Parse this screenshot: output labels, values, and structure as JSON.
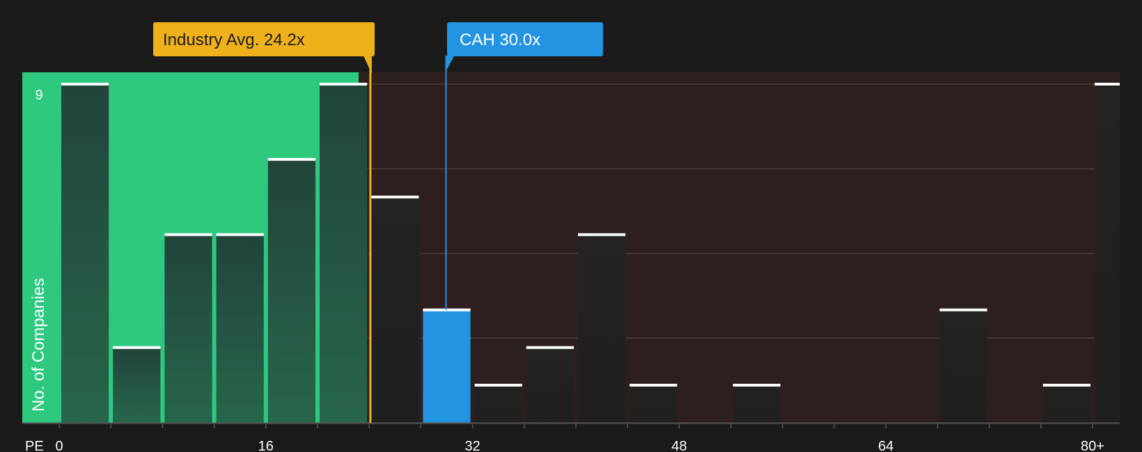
{
  "chart_data": {
    "type": "bar",
    "xlabel": "PE",
    "ylabel": "No. of Companies",
    "x_ticks": [
      "0",
      "16",
      "32",
      "48",
      "64",
      "80+"
    ],
    "y_max_label": "9",
    "ylim": [
      0,
      9
    ],
    "xlim": [
      0,
      80
    ],
    "bin_width": 4,
    "bins": [
      {
        "start": 0,
        "count": 9
      },
      {
        "start": 4,
        "count": 2
      },
      {
        "start": 8,
        "count": 5
      },
      {
        "start": 12,
        "count": 5
      },
      {
        "start": 16,
        "count": 7
      },
      {
        "start": 20,
        "count": 9
      },
      {
        "start": 24,
        "count": 6
      },
      {
        "start": 28,
        "count": 3,
        "highlight": true
      },
      {
        "start": 32,
        "count": 1
      },
      {
        "start": 36,
        "count": 2
      },
      {
        "start": 40,
        "count": 5
      },
      {
        "start": 44,
        "count": 1
      },
      {
        "start": 52,
        "count": 1
      },
      {
        "start": 68,
        "count": 3
      },
      {
        "start": 76,
        "count": 1
      },
      {
        "start": 80,
        "count": 9
      }
    ],
    "industry_avg": {
      "value": 24.2,
      "label": "Industry Avg. 24.2x"
    },
    "company": {
      "value": 30.0,
      "label": "CAH 30.0x"
    },
    "colors": {
      "background": "#1b1b1b",
      "undervalued_zone": "#2ec97e",
      "overvalued_zone": "#2e1f1f",
      "industry": "#eeb11c",
      "company": "#2394e1",
      "bar_cap": "#ffffff"
    }
  }
}
